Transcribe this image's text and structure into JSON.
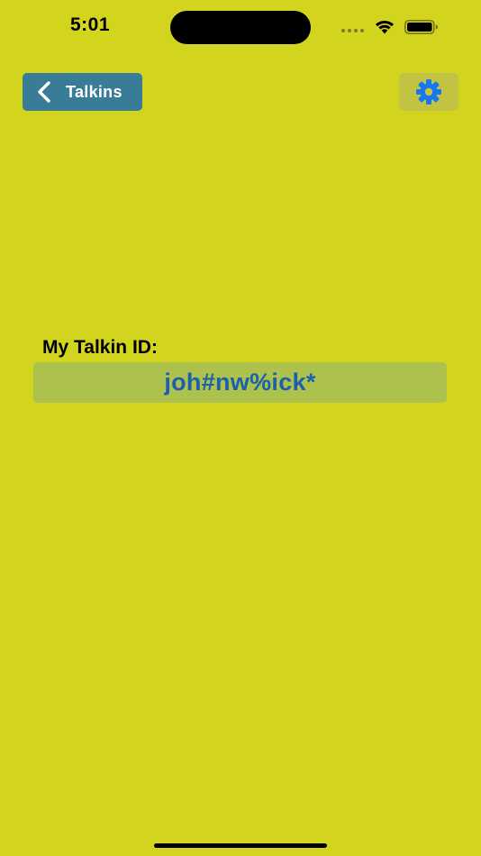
{
  "status_bar": {
    "time": "5:01",
    "icons": [
      "cellular-dots-icon",
      "wifi-icon",
      "battery-icon"
    ]
  },
  "header": {
    "back_label": "Talkins",
    "back_icon": "chevron-left-icon",
    "settings_icon": "gear-icon"
  },
  "profile": {
    "id_label": "My Talkin ID:",
    "id_value": "joh#nw%ick*"
  },
  "colors": {
    "background": "#d3d41e",
    "back_button": "#387c98",
    "settings_button": "#c2c343",
    "id_box": "#acc24c",
    "id_text": "#1b5fb0",
    "gear": "#1677f0"
  }
}
